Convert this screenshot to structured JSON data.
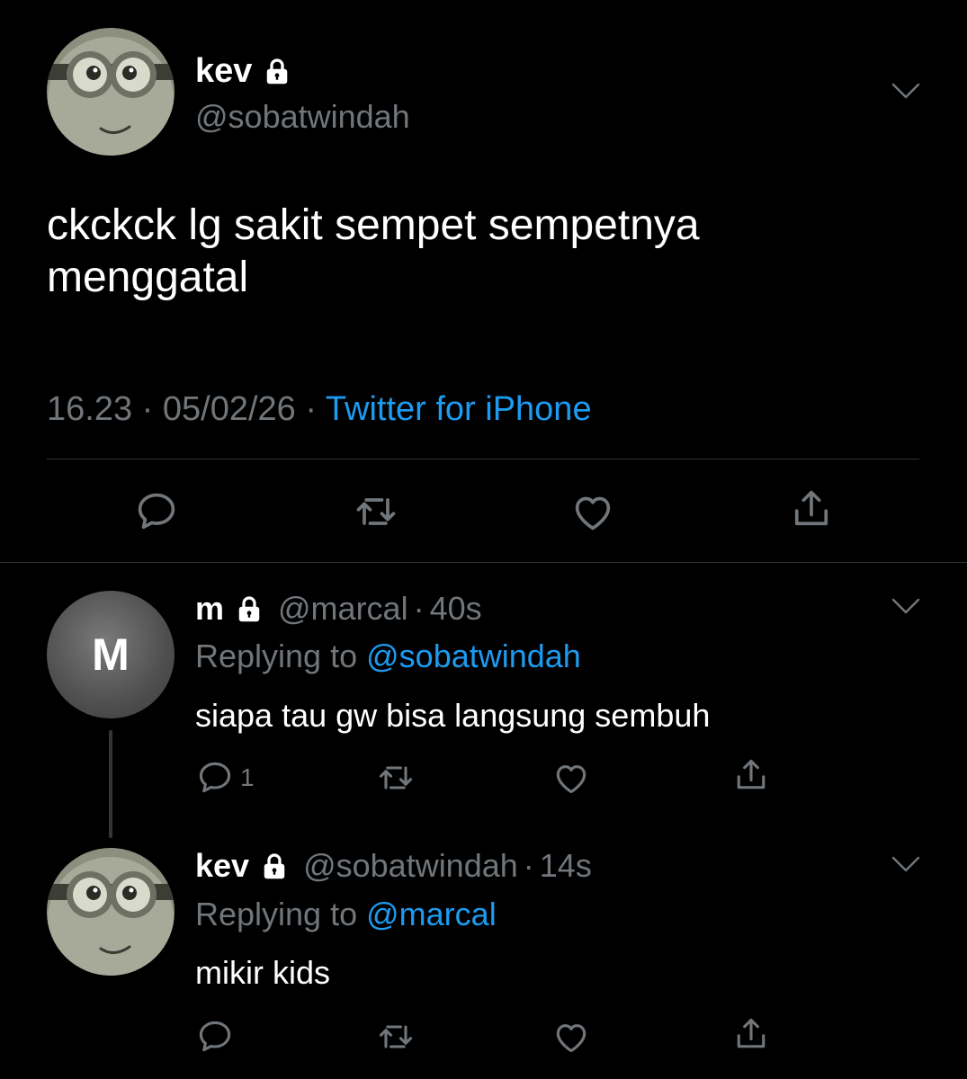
{
  "main_tweet": {
    "name": "kev",
    "handle": "@sobatwindah",
    "text": "ckckck lg sakit sempet sempetnya menggatal",
    "time": "16.23",
    "date": "05/02/26",
    "separator": "·",
    "source": "Twitter for iPhone",
    "icons": [
      "lock-icon",
      "chevron-down-icon",
      "reply-icon",
      "retweet-icon",
      "like-icon",
      "share-icon"
    ]
  },
  "replies": [
    {
      "name": "m",
      "handle": "@marcal",
      "separator": "·",
      "age": "40s",
      "replying_prefix": "Replying to",
      "replying_to": "@sobatwindah",
      "text": "siapa tau gw bisa langsung sembuh",
      "reply_count": "1",
      "avatar_letter": "M"
    },
    {
      "name": "kev",
      "handle": "@sobatwindah",
      "separator": "·",
      "age": "14s",
      "replying_prefix": "Replying to",
      "replying_to": "@marcal",
      "text": "mikir kids",
      "reply_count": ""
    }
  ],
  "colors": {
    "background": "#000000",
    "text": "#ffffff",
    "muted": "#71767b",
    "link": "#1d9bf0",
    "divider": "#2f3336"
  }
}
